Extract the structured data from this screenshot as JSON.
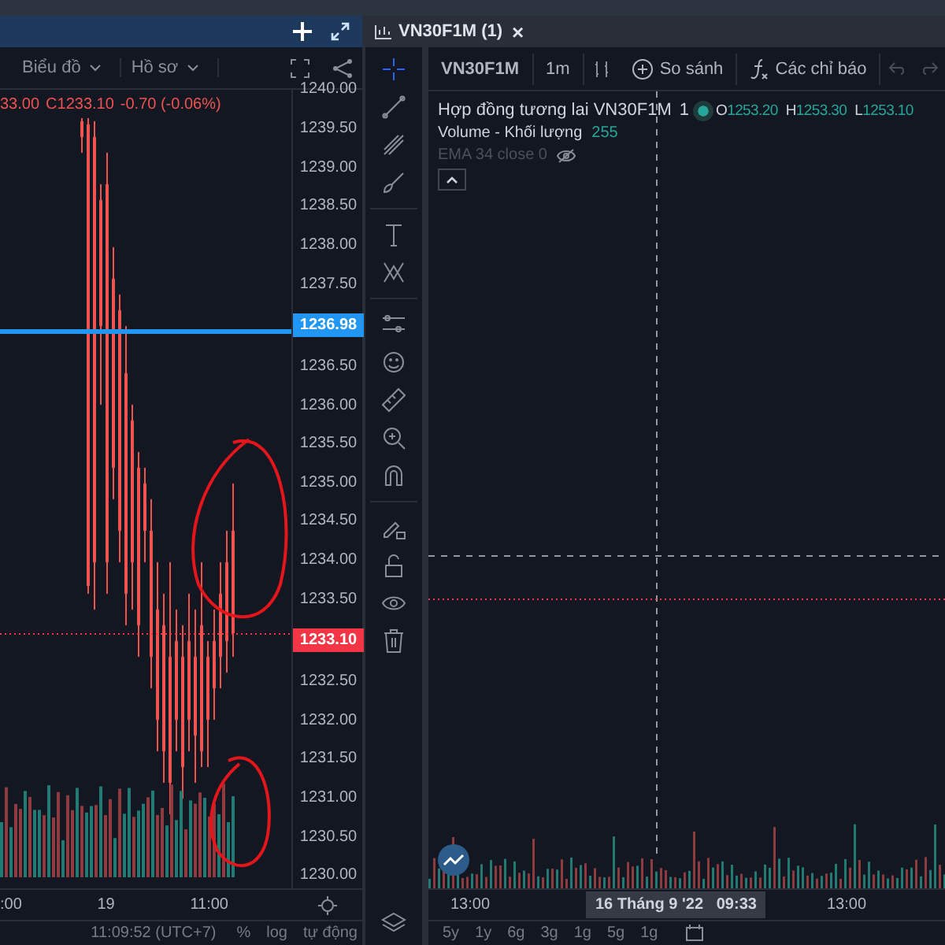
{
  "left_panel": {
    "toolbar": [
      {
        "label": "Biểu đồ"
      },
      {
        "label": "Hồ sơ"
      }
    ],
    "legend": [
      "33.00",
      "C1233.10",
      "-0.70 (-0.06%)"
    ],
    "price_axis": [
      {
        "text": "1240.00",
        "kind": "tick"
      },
      {
        "text": "1239.50",
        "kind": "tick"
      },
      {
        "text": "1239.00",
        "kind": "tick"
      },
      {
        "text": "1238.50",
        "kind": "tick"
      },
      {
        "text": "1238.00",
        "kind": "tick"
      },
      {
        "text": "1237.50",
        "kind": "tick"
      },
      {
        "text": "1236.98",
        "kind": "marker",
        "color": "#2196f3"
      },
      {
        "text": "1236.50",
        "kind": "tick"
      },
      {
        "text": "1236.00",
        "kind": "tick"
      },
      {
        "text": "1235.50",
        "kind": "tick"
      },
      {
        "text": "1235.00",
        "kind": "tick"
      },
      {
        "text": "1234.50",
        "kind": "tick"
      },
      {
        "text": "1234.00",
        "kind": "tick"
      },
      {
        "text": "1233.50",
        "kind": "tick"
      },
      {
        "text": "1233.10",
        "kind": "marker",
        "color": "#f23645"
      },
      {
        "text": "1232.50",
        "kind": "tick"
      },
      {
        "text": "1232.00",
        "kind": "tick"
      },
      {
        "text": "1231.50",
        "kind": "tick"
      },
      {
        "text": "1231.00",
        "kind": "tick"
      },
      {
        "text": "1230.50",
        "kind": "tick"
      },
      {
        "text": "1230.00",
        "kind": "tick"
      }
    ],
    "time_axis": [
      ":00",
      "19",
      "11:00"
    ],
    "status_bar": {
      "time": "11:09:52 (UTC+7)",
      "options": [
        "%",
        "log",
        "tự động"
      ]
    }
  },
  "right_panel": {
    "tab": {
      "title": "VN30F1M (1)",
      "close": "×"
    },
    "drawing_tools": [
      {
        "selected": true
      },
      {
        "selected": false
      },
      {
        "selected": false
      },
      {
        "selected": false
      },
      {
        "selected": false
      },
      {
        "selected": false
      },
      {
        "selected": false
      },
      {
        "selected": false
      },
      {
        "selected": false
      },
      {
        "selected": false
      },
      {
        "selected": false
      },
      {
        "selected": false
      },
      {
        "selected": false
      },
      {
        "selected": false
      },
      {
        "selected": false
      }
    ],
    "toolbar": {
      "symbol": "VN30F1M",
      "interval": "1m",
      "compare": "So sánh",
      "indicators": "Các chỉ báo"
    },
    "legend": {
      "name": "Hợp đồng tương lai VN30F1M",
      "interval": "1",
      "status_dot": {
        "color": "#26a69a"
      },
      "values": [
        {
          "label": "O",
          "value": "1253.20"
        },
        {
          "label": "H",
          "value": "1253.30"
        },
        {
          "label": "L",
          "value": "1253.10"
        }
      ]
    },
    "indicators": [
      {
        "name": "Volume - Khối lượng",
        "value": "255",
        "hidden": false
      },
      {
        "name": "EMA 34 close 0",
        "hidden": true
      }
    ],
    "time_axis": [
      "13:00",
      "13:00"
    ],
    "crosshair_label": {
      "date": "16 Tháng 9 '22",
      "time": "09:33"
    },
    "ranges": [
      "5y",
      "1y",
      "6g",
      "3g",
      "1g",
      "5g",
      "1g"
    ]
  }
}
